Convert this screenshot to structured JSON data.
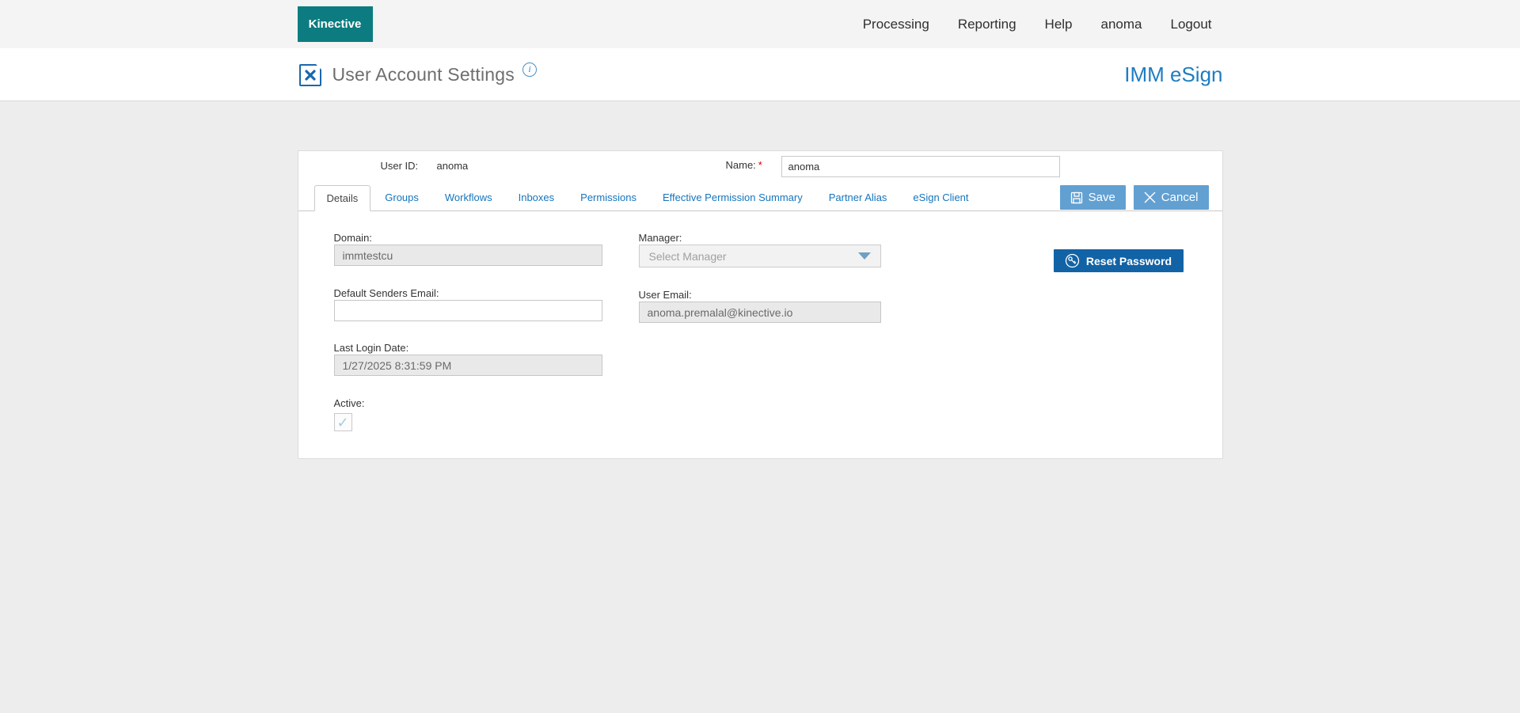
{
  "brand": {
    "logo_text": "Kinective",
    "product_name": "IMM eSign",
    "teal_color": "#0c7c80",
    "accent_blue": "#1575bd",
    "button_blue": "#62a0d2",
    "dark_button_blue": "#1263a5"
  },
  "top_nav": {
    "items": [
      "Processing",
      "Reporting",
      "Help",
      "anoma",
      "Logout"
    ]
  },
  "header": {
    "title": "User Account Settings",
    "info_glyph": "i"
  },
  "account": {
    "user_id_label": "User ID:",
    "user_id_value": "anoma",
    "name_label": "Name:",
    "required_marker": "*",
    "name_value": "anoma"
  },
  "tabs": [
    {
      "label": "Details",
      "active": true
    },
    {
      "label": "Groups",
      "active": false
    },
    {
      "label": "Workflows",
      "active": false
    },
    {
      "label": "Inboxes",
      "active": false
    },
    {
      "label": "Permissions",
      "active": false
    },
    {
      "label": "Effective Permission Summary",
      "active": false
    },
    {
      "label": "Partner Alias",
      "active": false
    },
    {
      "label": "eSign Client",
      "active": false
    }
  ],
  "actions": {
    "save_label": "Save",
    "cancel_label": "Cancel",
    "reset_password_label": "Reset Password"
  },
  "form": {
    "domain_label": "Domain:",
    "domain_value": "immtestcu",
    "manager_label": "Manager:",
    "manager_placeholder": "Select Manager",
    "default_senders_email_label": "Default Senders Email:",
    "default_senders_email_value": "",
    "user_email_label": "User Email:",
    "user_email_value": "anoma.premalal@kinective.io",
    "last_login_label": "Last Login Date:",
    "last_login_value": "1/27/2025 8:31:59 PM",
    "active_label": "Active:",
    "active_checked": true,
    "active_glyph": "✓"
  }
}
